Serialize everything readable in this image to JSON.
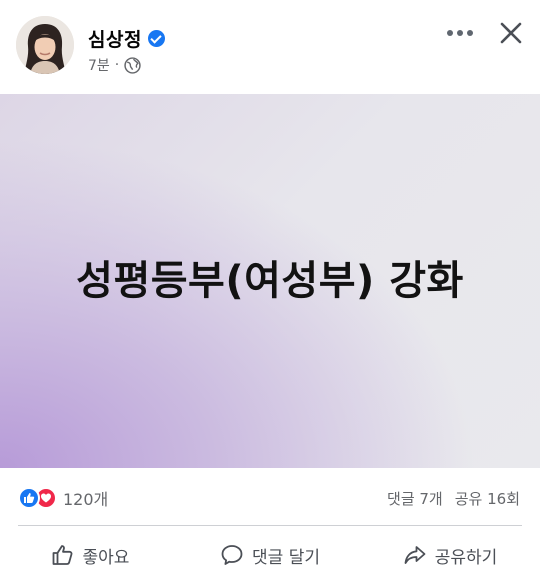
{
  "post": {
    "author": "심상정",
    "time": "7분",
    "separator": "·",
    "image_text": "성평등부(여성부) 강화"
  },
  "icons": {
    "verified": "verified-badge-icon",
    "audience": "globe-icon",
    "more": "more-options-icon",
    "close": "close-icon"
  },
  "stats": {
    "reaction_count": "120개",
    "comments": "댓글 7개",
    "shares": "공유 16회"
  },
  "actions": {
    "like": "좋아요",
    "comment": "댓글 달기",
    "share": "공유하기"
  },
  "colors": {
    "brand_blue": "#1877f2",
    "love_red": "#f0284a",
    "secondary_text": "#65676b"
  }
}
